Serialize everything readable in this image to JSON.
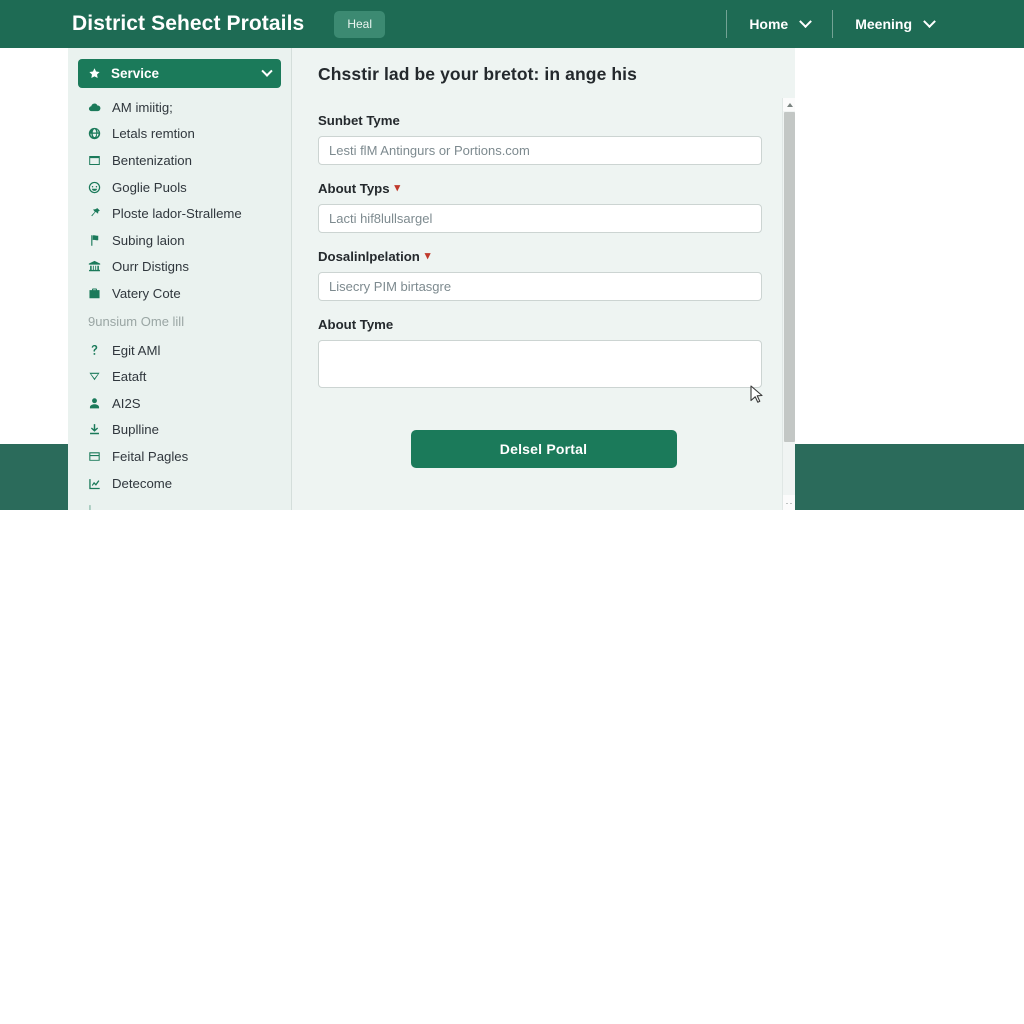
{
  "header": {
    "title": "District Sehect Protails",
    "badge": "Heal",
    "nav": [
      {
        "label": "Home",
        "icon": "chevron-down-icon"
      },
      {
        "label": "Meening",
        "icon": "chevron-down-icon"
      }
    ]
  },
  "sidebar": {
    "active": {
      "label": "Service",
      "icon": "star-icon",
      "chevron": "chevron-down-icon"
    },
    "items": [
      {
        "label": "AM imiitig;",
        "icon": "cloud-icon"
      },
      {
        "label": "Letals remtion",
        "icon": "globe-icon"
      },
      {
        "label": "Bentenization",
        "icon": "window-icon"
      },
      {
        "label": "Goglie Puols",
        "icon": "smiley-icon"
      },
      {
        "label": "Ploste lador-Stralleme",
        "icon": "pin-icon"
      },
      {
        "label": "Subing laion",
        "icon": "flag-icon"
      },
      {
        "label": "Ourr Distigns",
        "icon": "bank-icon"
      },
      {
        "label": "Vatery Cote",
        "icon": "briefcase-icon"
      }
    ],
    "group_label": "9unsium Ome lill",
    "group_items": [
      {
        "label": "Egit AMl",
        "icon": "question-icon"
      },
      {
        "label": "Eataft",
        "icon": "tag-icon"
      },
      {
        "label": "AI2S",
        "icon": "user-icon"
      },
      {
        "label": "Buplline",
        "icon": "download-icon"
      },
      {
        "label": "Feital Pagles",
        "icon": "card-icon"
      },
      {
        "label": "Detecome",
        "icon": "chart-icon"
      }
    ]
  },
  "main": {
    "title": "Chsstir lad be your bretot: in ange his",
    "fields": [
      {
        "label": "Sunbet Tyme",
        "required": false,
        "type": "input",
        "placeholder": "Lesti flM Antingurs or Portions.com",
        "value": ""
      },
      {
        "label": "About Typs",
        "required": true,
        "type": "input",
        "placeholder": "Lacti hif8lullsargel",
        "value": ""
      },
      {
        "label": "Dosalinlpelation",
        "required": true,
        "type": "input",
        "placeholder": "Lisecry PIM birtasgre",
        "value": ""
      },
      {
        "label": "About Tyme",
        "required": false,
        "type": "textarea",
        "placeholder": "",
        "value": ""
      }
    ],
    "submit_label": "Delsel Portal",
    "required_marker": "▾"
  },
  "scrollbar": {
    "up_icon": "caret-up-icon",
    "down_icon": "resize-grip-icon",
    "down_label": "··"
  },
  "colors": {
    "header_green": "#1e6b54",
    "accent_green": "#1b7a5a",
    "badge_green": "#3c8a72",
    "footer_green": "#2b6b5b",
    "card_bg": "#eef4f2",
    "sidebar_bg": "#eaf2ef",
    "required_red": "#c0392b"
  }
}
